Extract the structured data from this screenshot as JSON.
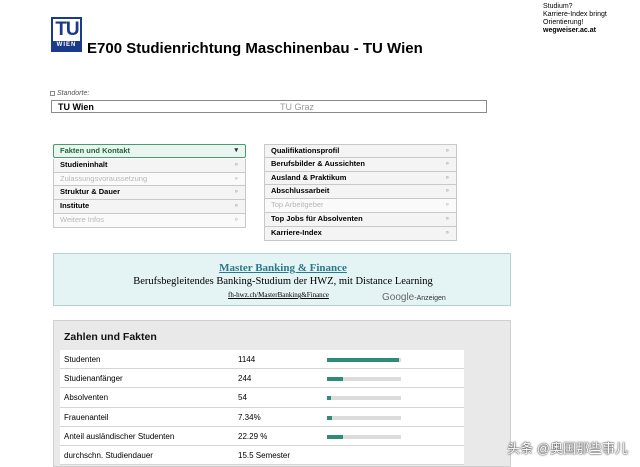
{
  "logo": {
    "top_text": "TU",
    "bottom_text": "WIEN"
  },
  "page_title": "E700 Studienrichtung Maschinenbau - TU Wien",
  "top_right": {
    "line1": "Studium?",
    "line2": "Karriere-Index bringt",
    "line3": "Orientierung!",
    "link": "wegweiser.ac.at"
  },
  "standorte": {
    "label": "Standorte:",
    "items": [
      "TU Wien",
      "TU Graz"
    ]
  },
  "menu_left": [
    {
      "label": "Fakten und Kontakt",
      "state": "head",
      "arrow": "▾"
    },
    {
      "label": "Studieninhalt",
      "state": "active",
      "arrow": "»"
    },
    {
      "label": "Zulassungsvoraussetzung",
      "state": "disabled",
      "arrow": "»"
    },
    {
      "label": "Struktur & Dauer",
      "state": "active",
      "arrow": "»"
    },
    {
      "label": "Institute",
      "state": "active",
      "arrow": "»"
    },
    {
      "label": "Weitere Infos",
      "state": "disabled",
      "arrow": "»"
    }
  ],
  "menu_right": [
    {
      "label": "Qualifikationsprofil",
      "state": "active",
      "arrow": "»"
    },
    {
      "label": "Berufsbilder & Aussichten",
      "state": "active",
      "arrow": "»"
    },
    {
      "label": "Ausland & Praktikum",
      "state": "active",
      "arrow": "»"
    },
    {
      "label": "Abschlussarbeit",
      "state": "active",
      "arrow": "»"
    },
    {
      "label": "Top Arbeitgeber",
      "state": "disabled",
      "arrow": "»"
    },
    {
      "label": "Top Jobs für Absolventen",
      "state": "active",
      "arrow": "»"
    },
    {
      "label": "Karriere-Index",
      "state": "active",
      "arrow": "»"
    }
  ],
  "ad": {
    "title": "Master Banking & Finance",
    "text": "Berufsbegleitendes Banking-Studium der HWZ, mit Distance Learning",
    "url": "fh-hwz.ch/MasterBanking&Finance",
    "google": "Google",
    "anzeigen": "-Anzeigen"
  },
  "stats": {
    "heading": "Zahlen und Fakten",
    "rows": [
      {
        "label": "Studenten",
        "value": "1144",
        "bar": 0.97
      },
      {
        "label": "Studienanfänger",
        "value": "244",
        "bar": 0.21
      },
      {
        "label": "Absolventen",
        "value": "54",
        "bar": 0.05
      },
      {
        "label": "Frauenanteil",
        "value": "7.34%",
        "bar": 0.07
      },
      {
        "label": "Anteil ausländischer Studenten",
        "value": "22.29 %",
        "bar": 0.22
      },
      {
        "label": "durchschn. Studiendauer",
        "value": "15.5 Semester",
        "bar": 0.0
      }
    ],
    "bar_color": "#2e8b7a"
  },
  "watermark": "头条 @奥国那些事儿",
  "colors": {
    "logo_blue": "#1a3a8a",
    "ad_bg": "#e4f4f4",
    "ad_link": "#2a7a8a",
    "menu_head": "#1a6a3a"
  }
}
